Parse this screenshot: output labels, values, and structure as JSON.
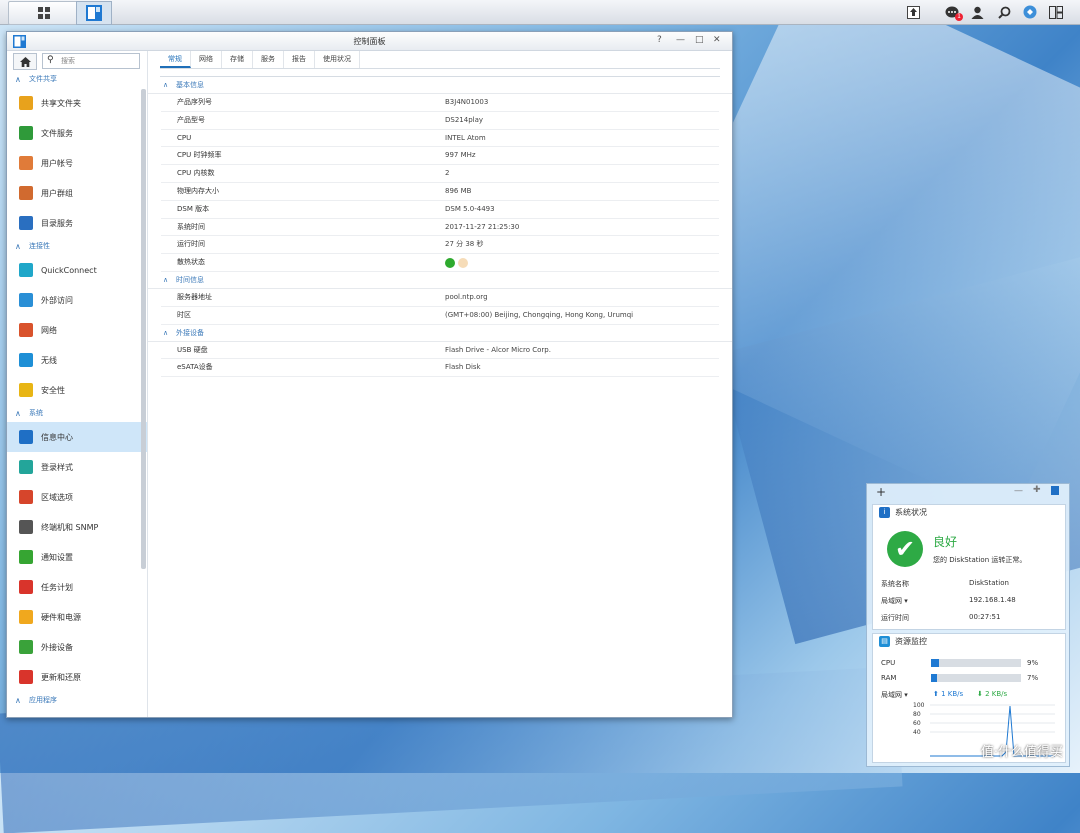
{
  "taskbar": {
    "notification_count": "1"
  },
  "window": {
    "title": "控制面板"
  },
  "sidebar": {
    "search_placeholder": "搜索",
    "sections": [
      {
        "label": "文件共享",
        "items": [
          {
            "label": "共享文件夹",
            "icon": "shared-folder-icon",
            "color": "#e8a21c"
          },
          {
            "label": "文件服务",
            "icon": "file-services-icon",
            "color": "#2f9a3a"
          },
          {
            "label": "用户帐号",
            "icon": "user-icon",
            "color": "#e07b39"
          },
          {
            "label": "用户群组",
            "icon": "group-icon",
            "color": "#d16a2f"
          },
          {
            "label": "目录服务",
            "icon": "directory-icon",
            "color": "#2a6fc0"
          }
        ]
      },
      {
        "label": "连接性",
        "items": [
          {
            "label": "QuickConnect",
            "icon": "quickconnect-icon",
            "color": "#20a7c9"
          },
          {
            "label": "外部访问",
            "icon": "external-access-icon",
            "color": "#2a8fd6"
          },
          {
            "label": "网络",
            "icon": "network-icon",
            "color": "#d9532c"
          },
          {
            "label": "无线",
            "icon": "wireless-icon",
            "color": "#1e8fd6"
          },
          {
            "label": "安全性",
            "icon": "security-icon",
            "color": "#e8b514"
          }
        ]
      },
      {
        "label": "系统",
        "items": [
          {
            "label": "信息中心",
            "icon": "info-icon",
            "color": "#1f6fc5",
            "active": true
          },
          {
            "label": "登录样式",
            "icon": "theme-icon",
            "color": "#23a59a"
          },
          {
            "label": "区域选项",
            "icon": "regional-icon",
            "color": "#d6452b"
          },
          {
            "label": "终端机和 SNMP",
            "icon": "terminal-icon",
            "color": "#555555"
          },
          {
            "label": "通知设置",
            "icon": "notification-icon",
            "color": "#36a532"
          },
          {
            "label": "任务计划",
            "icon": "calendar-icon",
            "color": "#d9342b"
          },
          {
            "label": "硬件和电源",
            "icon": "power-icon",
            "color": "#f0a81e"
          },
          {
            "label": "外接设备",
            "icon": "external-device-icon",
            "color": "#3aa23a"
          },
          {
            "label": "更新和还原",
            "icon": "update-icon",
            "color": "#d9342b"
          }
        ]
      },
      {
        "label": "应用程序",
        "items": []
      }
    ]
  },
  "tabs": [
    "常规",
    "网络",
    "存储",
    "服务",
    "报告",
    "使用状况"
  ],
  "info": {
    "groups": [
      {
        "label": "基本信息",
        "rows": [
          {
            "key": "产品序列号",
            "value": "B3J4N01003"
          },
          {
            "key": "产品型号",
            "value": "DS214play"
          },
          {
            "key": "CPU",
            "value": "INTEL Atom"
          },
          {
            "key": "CPU 时钟频率",
            "value": "997 MHz"
          },
          {
            "key": "CPU 内核数",
            "value": "2"
          },
          {
            "key": "物理内存大小",
            "value": "896 MB"
          },
          {
            "key": "DSM 版本",
            "value": "DSM 5.0-4493"
          },
          {
            "key": "系统时间",
            "value": "2017-11-27 21:25:30"
          },
          {
            "key": "运行时间",
            "value": "27 分 38 秒"
          },
          {
            "key": "散热状态",
            "value": ""
          }
        ]
      },
      {
        "label": "时间信息",
        "rows": [
          {
            "key": "服务器地址",
            "value": "pool.ntp.org"
          },
          {
            "key": "时区",
            "value": "(GMT+08:00) Beijing, Chongqing, Hong Kong, Urumqi"
          }
        ]
      },
      {
        "label": "外接设备",
        "rows": [
          {
            "key": "USB 硬盘",
            "value": "Flash Drive - Alcor Micro Corp."
          },
          {
            "key": "eSATA设备",
            "value": "Flash Disk"
          }
        ]
      }
    ]
  },
  "widget": {
    "status_title": "系统状况",
    "status_word": "良好",
    "status_desc": "您的 DiskStation 运转正常。",
    "system_name_label": "系统名称",
    "system_name": "DiskStation",
    "lan_label": "局域网 ▾",
    "lan_ip": "192.168.1.48",
    "uptime_label": "运行时间",
    "uptime": "00:27:51",
    "monitor_title": "资源监控",
    "cpu_label": "CPU",
    "cpu_pct": "9%",
    "cpu_value": 0.09,
    "ram_label": "RAM",
    "ram_pct": "7%",
    "ram_value": 0.07,
    "net_label": "局域网 ▾",
    "upload": "1 KB/s",
    "download": "2 KB/s",
    "chart_ticks": [
      "100",
      "80",
      "60",
      "40"
    ]
  },
  "watermark": "值·什么值得买"
}
